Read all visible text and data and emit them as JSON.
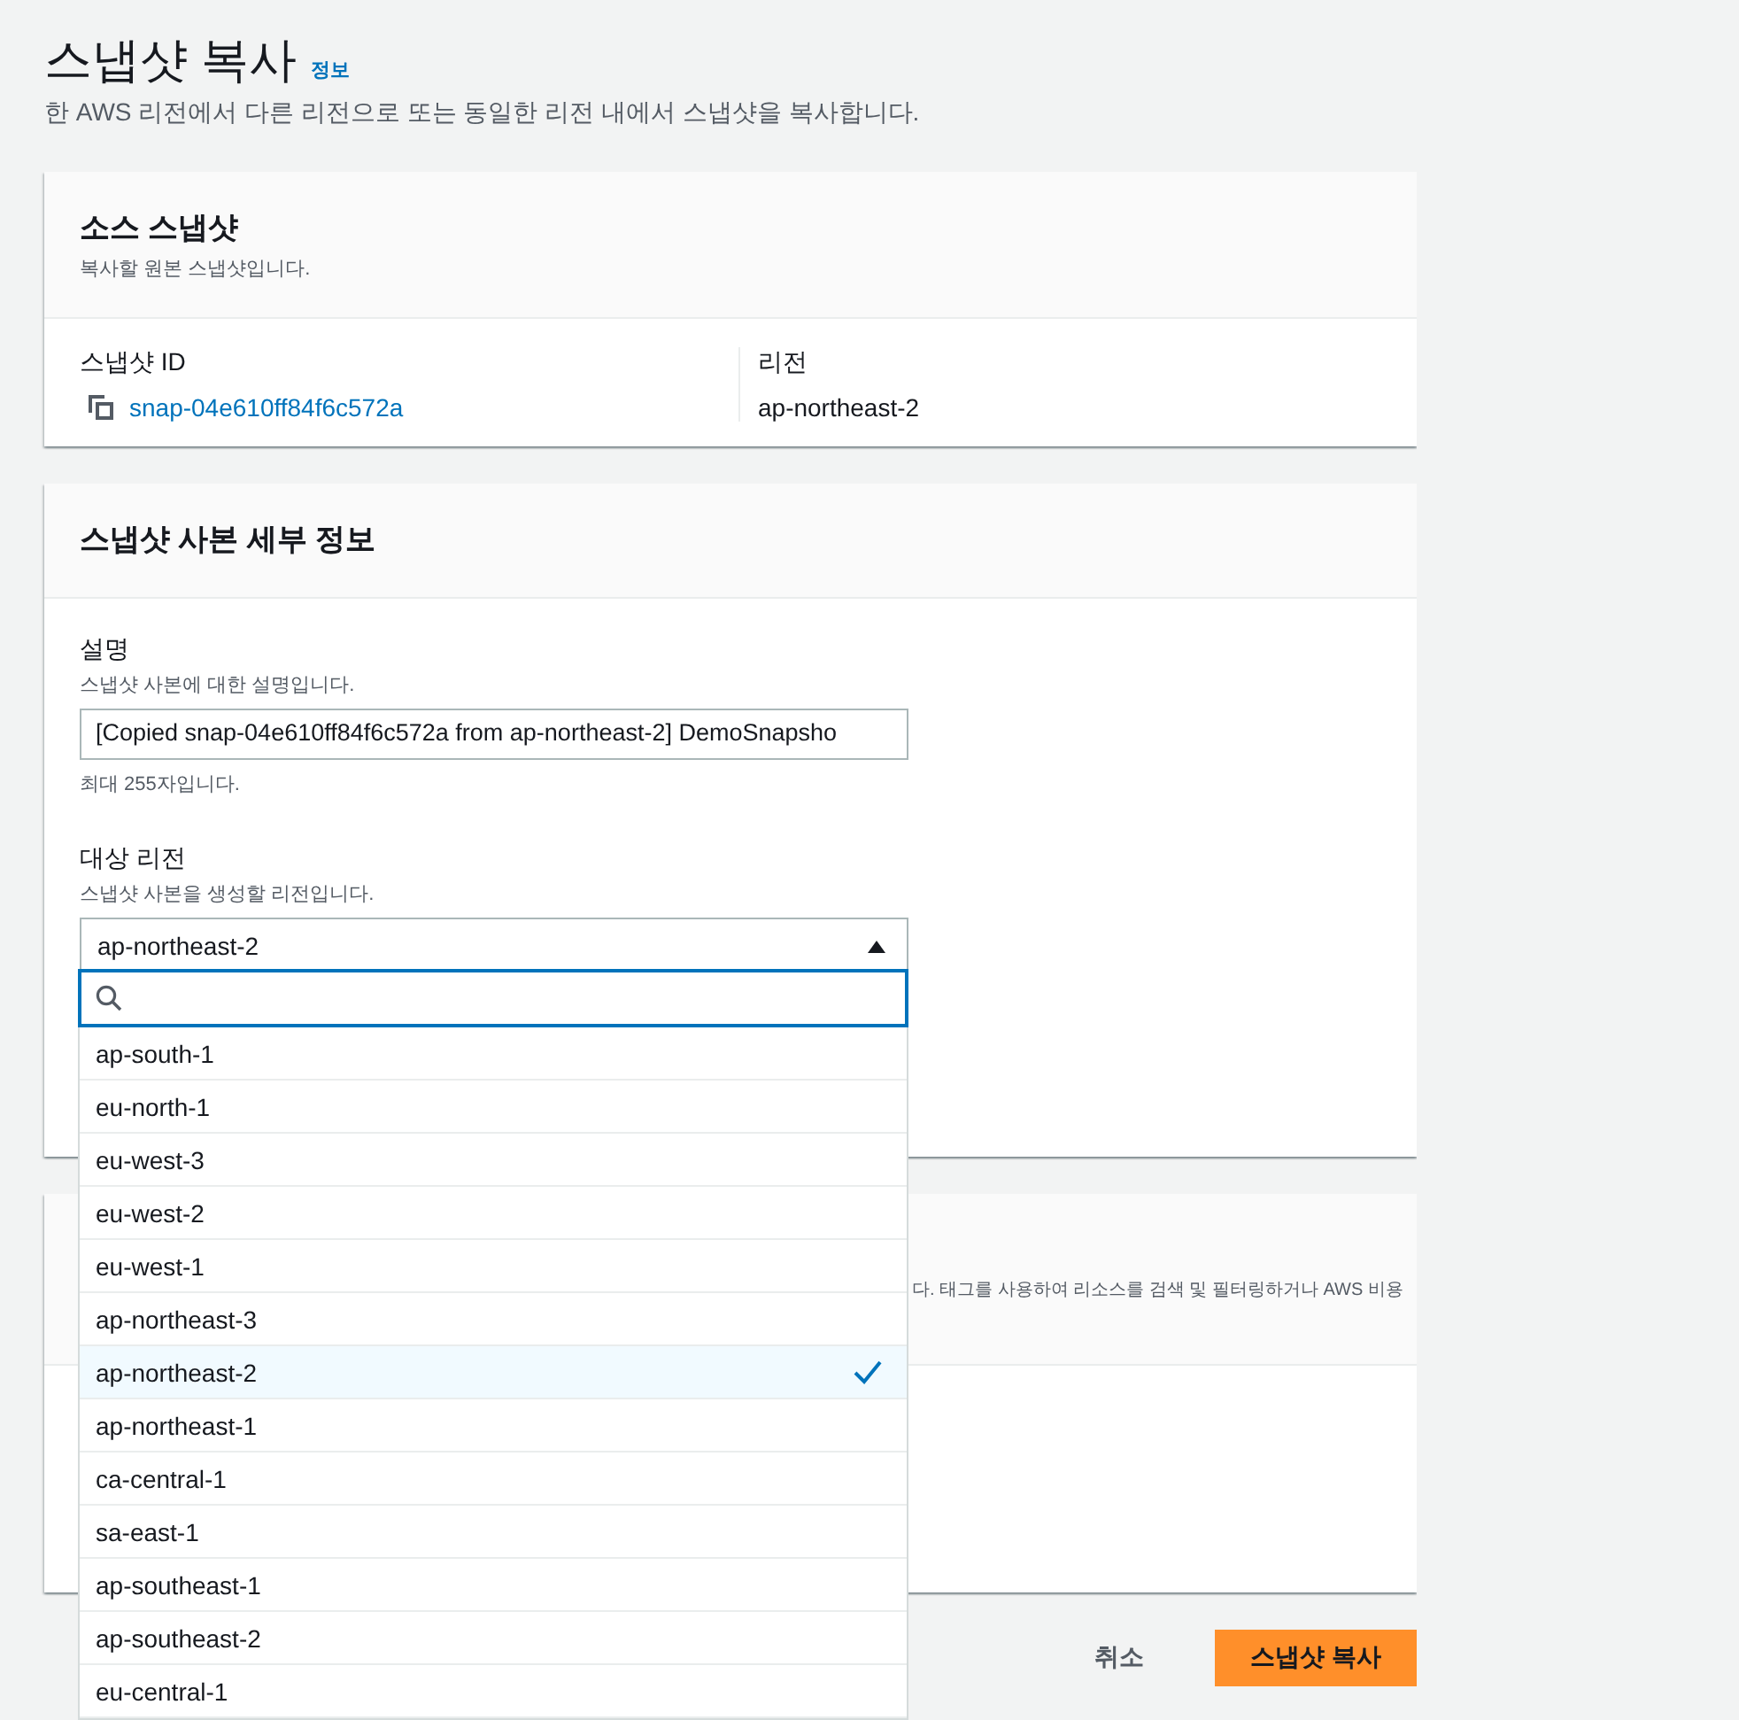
{
  "page": {
    "title": "스냅샷 복사",
    "info_link": "정보",
    "description": "한 AWS 리전에서 다른 리전으로 또는 동일한 리전 내에서 스냅샷을 복사합니다."
  },
  "source": {
    "title": "소스 스냅샷",
    "subtitle": "복사할 원본 스냅샷입니다.",
    "fields": [
      {
        "label": "스냅샷 ID",
        "value": "snap-04e610ff84f6c572a",
        "kind": "link"
      },
      {
        "label": "리전",
        "value": "ap-northeast-2",
        "kind": "text"
      }
    ]
  },
  "details": {
    "title": "스냅샷 사본 세부 정보",
    "description_field": {
      "label": "설명",
      "hint": "스냅샷 사본에 대한 설명입니다.",
      "value": "[Copied snap-04e610ff84f6c572a from ap-northeast-2] DemoSnapsho",
      "constraint": "최대 255자입니다."
    },
    "region_field": {
      "label": "대상 리전",
      "hint": "스냅샷 사본을 생성할 리전입니다.",
      "value": "ap-northeast-2",
      "expanded": true,
      "options": [
        {
          "label": "ap-south-1",
          "selected": false
        },
        {
          "label": "eu-north-1",
          "selected": false
        },
        {
          "label": "eu-west-3",
          "selected": false
        },
        {
          "label": "eu-west-2",
          "selected": false
        },
        {
          "label": "eu-west-1",
          "selected": false
        },
        {
          "label": "ap-northeast-3",
          "selected": false
        },
        {
          "label": "ap-northeast-2",
          "selected": true
        },
        {
          "label": "ap-northeast-1",
          "selected": false
        },
        {
          "label": "ca-central-1",
          "selected": false
        },
        {
          "label": "sa-east-1",
          "selected": false
        },
        {
          "label": "ap-southeast-1",
          "selected": false
        },
        {
          "label": "ap-southeast-2",
          "selected": false
        },
        {
          "label": "eu-central-1",
          "selected": false
        }
      ]
    }
  },
  "tags": {
    "description": "다. 태그를 사용하여 리소스를 검색 및 필터링하거나 AWS 비용"
  },
  "buttons": [
    {
      "label": "취소",
      "kind": "link"
    },
    {
      "label": "스냅샷 복사",
      "kind": "primary"
    }
  ]
}
